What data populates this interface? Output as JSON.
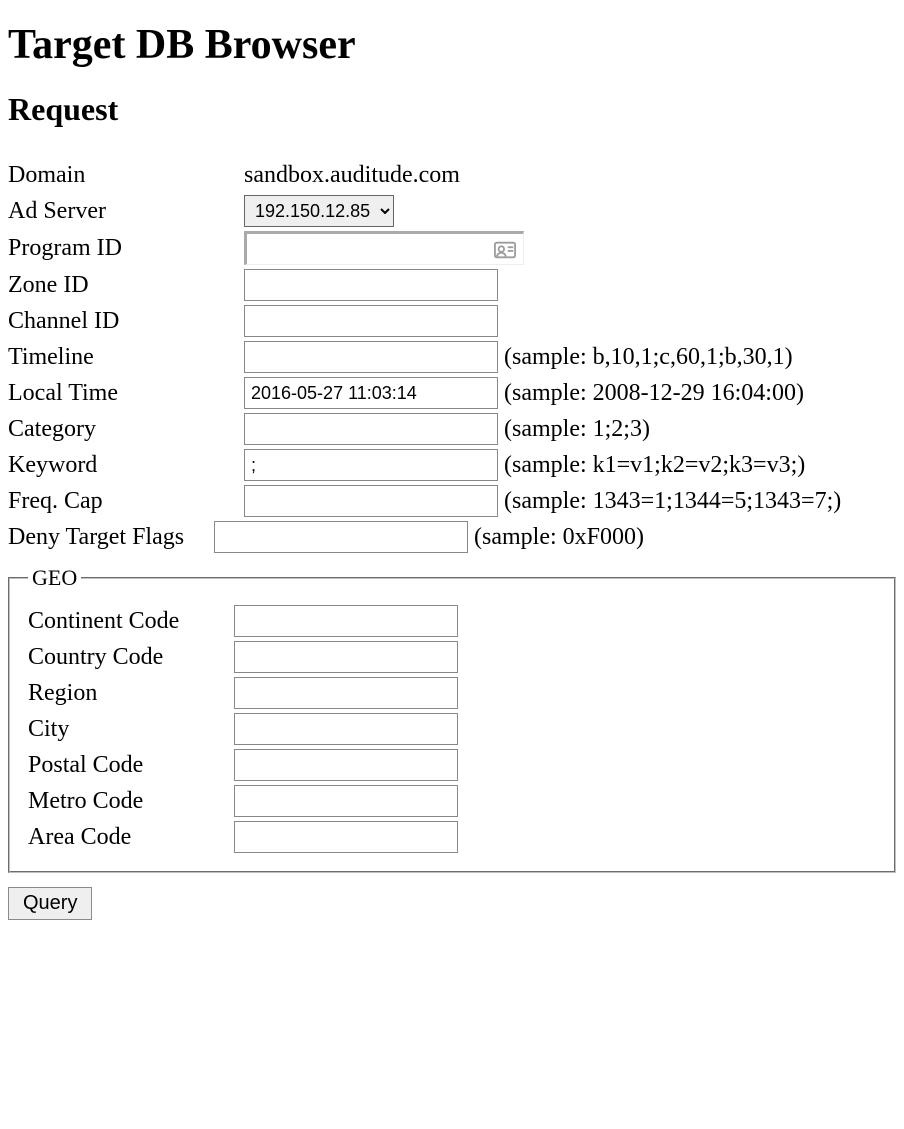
{
  "page": {
    "title": "Target DB Browser",
    "section": "Request"
  },
  "form": {
    "domain_label": "Domain",
    "domain_value": "sandbox.auditude.com",
    "adserver_label": "Ad Server",
    "adserver_value": "192.150.12.85",
    "program_id_label": "Program ID",
    "program_id_value": "",
    "zone_id_label": "Zone ID",
    "zone_id_value": "",
    "channel_id_label": "Channel ID",
    "channel_id_value": "",
    "timeline_label": "Timeline",
    "timeline_value": "",
    "timeline_hint": "(sample: b,10,1;c,60,1;b,30,1)",
    "localtime_label": "Local Time",
    "localtime_value": "2016-05-27 11:03:14",
    "localtime_hint": "(sample: 2008-12-29 16:04:00)",
    "category_label": "Category",
    "category_value": "",
    "category_hint": "(sample: 1;2;3)",
    "keyword_label": "Keyword",
    "keyword_value": ";",
    "keyword_hint": "(sample: k1=v1;k2=v2;k3=v3;)",
    "freqcap_label": "Freq. Cap",
    "freqcap_value": "",
    "freqcap_hint": "(sample: 1343=1;1344=5;1343=7;)",
    "denyflags_label": "Deny Target Flags",
    "denyflags_value": "",
    "denyflags_hint": "(sample: 0xF000)"
  },
  "geo": {
    "legend": "GEO",
    "continent_label": "Continent Code",
    "continent_value": "",
    "country_label": "Country Code",
    "country_value": "",
    "region_label": "Region",
    "region_value": "",
    "city_label": "City",
    "city_value": "",
    "postal_label": "Postal Code",
    "postal_value": "",
    "metro_label": "Metro Code",
    "metro_value": "",
    "area_label": "Area Code",
    "area_value": ""
  },
  "actions": {
    "query_label": "Query"
  }
}
